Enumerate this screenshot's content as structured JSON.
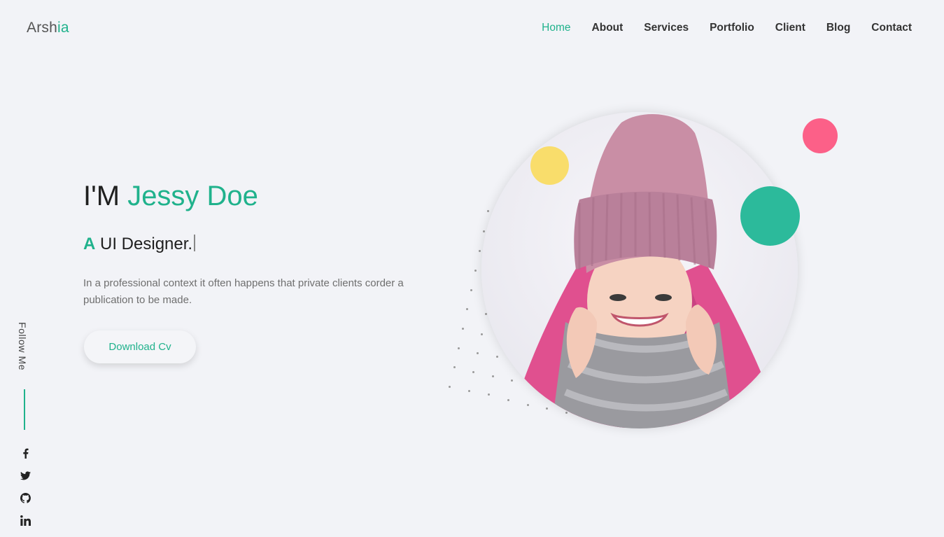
{
  "logo": {
    "prefix": "Arsh",
    "accent": "ia"
  },
  "nav": {
    "items": [
      {
        "label": "Home",
        "active": true
      },
      {
        "label": "About"
      },
      {
        "label": "Services"
      },
      {
        "label": "Portfolio"
      },
      {
        "label": "Client"
      },
      {
        "label": "Blog"
      },
      {
        "label": "Contact"
      }
    ]
  },
  "hero": {
    "intro": "I'M ",
    "name": "Jessy Doe",
    "sub_accent": "A",
    "sub_text": " UI Designer.",
    "description": "In a professional context it often happens that private clients corder a publication to be made.",
    "cta": "Download Cv"
  },
  "sidebar": {
    "follow_label": "Follow Me",
    "socials": [
      "facebook-icon",
      "twitter-icon",
      "github-icon",
      "linkedin-icon"
    ]
  },
  "colors": {
    "accent": "#20b28c",
    "bubble_yellow": "#f9dd6b",
    "bubble_pink": "#fc6088",
    "bubble_green": "#2cba9b",
    "background": "#f2f3f7"
  }
}
